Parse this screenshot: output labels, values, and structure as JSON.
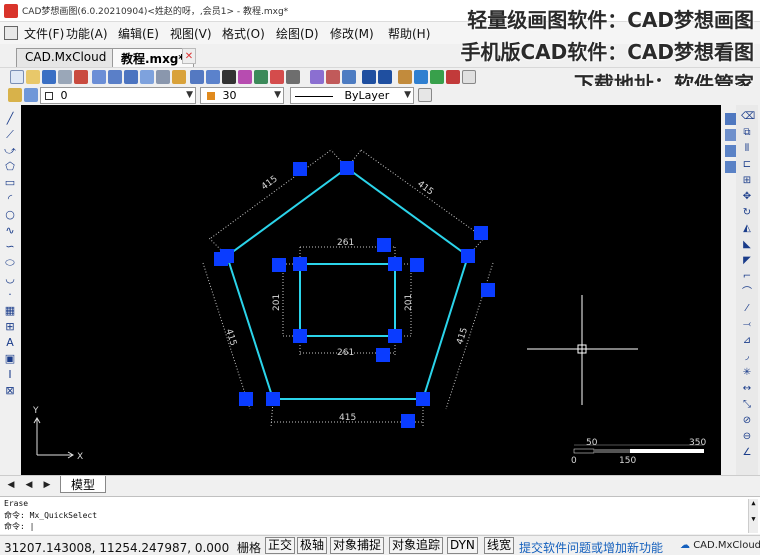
{
  "window": {
    "title": "CAD梦想画图(6.0.20210904)<姓赵的呀，,会员1> - 教程.mxg*"
  },
  "menu": {
    "items": [
      "文件(F)",
      "功能(A)",
      "编辑(E)",
      "视图(V)",
      "格式(O)",
      "绘图(D)",
      "修改(M)",
      "帮助(H)"
    ]
  },
  "overlay": {
    "lines": [
      "轻量级画图软件：CAD梦想画图",
      "手机版CAD软件：CAD梦想看图",
      "下载地址：软件管家"
    ]
  },
  "tabs": [
    {
      "label": "CAD.MxCloud",
      "active": false
    },
    {
      "label": "教程.mxg*",
      "active": true
    }
  ],
  "layer_bar": {
    "layer_value": "0",
    "color_value": "30",
    "linetype_value": "ByLayer",
    "layer_color": "#ffffff",
    "color_swatch": "#e08a1e"
  },
  "drawing": {
    "line_color": "#2bd4ea",
    "grip_color": "#0a3cff",
    "dimension_color": "#c8c8c8",
    "dims": {
      "pentagon_side": "415",
      "rect_width": "261",
      "rect_height": "201"
    },
    "scale_bar": {
      "top_labels": [
        "50",
        "350"
      ],
      "bottom_labels": [
        "0",
        "150"
      ]
    },
    "ucs": {
      "x_label": "X",
      "y_label": "Y"
    }
  },
  "bottom": {
    "model_tab": "模型"
  },
  "command": {
    "history": [
      " Erase",
      "命令: Mx_QuickSelect"
    ],
    "prompt": "命令: "
  },
  "status": {
    "coords": "31207.143008, 11254.247987, 0.000",
    "grid_label": "栅格",
    "buttons": [
      "正交",
      "极轴",
      "对象捕捉",
      "对象追踪",
      "DYN",
      "线宽"
    ],
    "link": "提交软件问题或增加新功能",
    "brand": "CAD.MxCloud"
  }
}
